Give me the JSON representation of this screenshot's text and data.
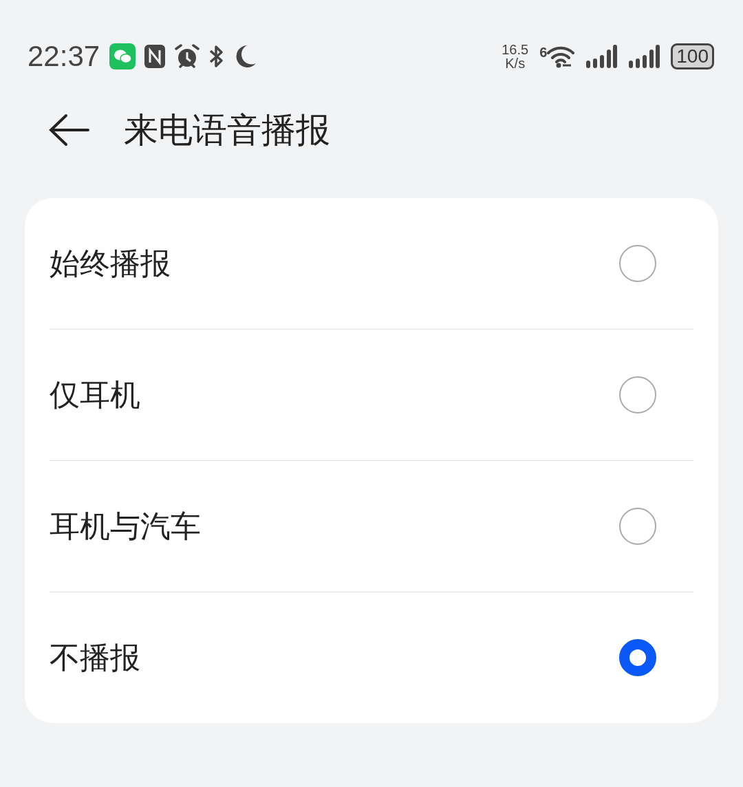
{
  "status_bar": {
    "time": "22:37",
    "net_speed_value": "16.5",
    "net_speed_unit": "K/s",
    "wifi_generation": "6",
    "battery": "100"
  },
  "header": {
    "title": "来电语音播报"
  },
  "options": [
    {
      "label": "始终播报",
      "selected": false
    },
    {
      "label": "仅耳机",
      "selected": false
    },
    {
      "label": "耳机与汽车",
      "selected": false
    },
    {
      "label": "不播报",
      "selected": true
    }
  ]
}
